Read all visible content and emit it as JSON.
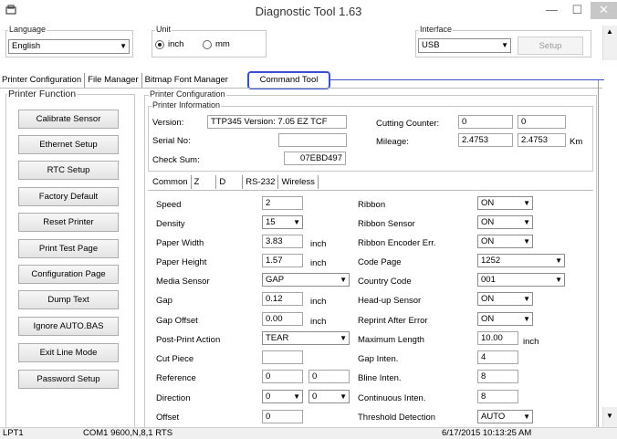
{
  "window": {
    "title": "Diagnostic Tool 1.63"
  },
  "top": {
    "language_legend": "Language",
    "language_value": "English",
    "unit_legend": "Unit",
    "unit_inch": "inch",
    "unit_mm": "mm",
    "interface_legend": "Interface",
    "interface_value": "USB",
    "setup_label": "Setup"
  },
  "tabs": [
    "Printer Configuration",
    "File Manager",
    "Bitmap Font Manager",
    "Command Tool"
  ],
  "printer_function": {
    "legend": "Printer Function",
    "buttons": [
      "Calibrate Sensor",
      "Ethernet Setup",
      "RTC Setup",
      "Factory Default",
      "Reset Printer",
      "Print Test Page",
      "Configuration Page",
      "Dump Text",
      "Ignore AUTO.BAS",
      "Exit Line Mode",
      "Password Setup"
    ]
  },
  "config": {
    "legend": "Printer Configuration",
    "info_legend": "Printer Information",
    "version_label": "Version:",
    "version_value": "TTP345 Version: 7.05 EZ TCF",
    "serial_label": "Serial No:",
    "serial_value": "",
    "checksum_label": "Check Sum:",
    "checksum_value": "07EBD497",
    "cutting_label": "Cutting Counter:",
    "cutting_1": "0",
    "cutting_2": "0",
    "mileage_label": "Mileage:",
    "mileage_1": "2.4753",
    "mileage_2": "2.4753",
    "mileage_unit": "Km"
  },
  "subtabs": [
    "Common",
    "Z",
    "D",
    "RS-232",
    "Wireless"
  ],
  "params_left": {
    "speed": {
      "label": "Speed",
      "value": "2"
    },
    "density": {
      "label": "Density",
      "value": "15"
    },
    "paper_width": {
      "label": "Paper Width",
      "value": "3.83",
      "unit": "inch"
    },
    "paper_height": {
      "label": "Paper Height",
      "value": "1.57",
      "unit": "inch"
    },
    "media_sensor": {
      "label": "Media Sensor",
      "value": "GAP"
    },
    "gap": {
      "label": "Gap",
      "value": "0.12",
      "unit": "inch"
    },
    "gap_offset": {
      "label": "Gap Offset",
      "value": "0.00",
      "unit": "inch"
    },
    "post_print": {
      "label": "Post-Print Action",
      "value": "TEAR"
    },
    "cut_piece": {
      "label": "Cut Piece",
      "value": ""
    },
    "reference": {
      "label": "Reference",
      "value1": "0",
      "value2": "0"
    },
    "direction": {
      "label": "Direction",
      "value1": "0",
      "value2": "0"
    },
    "offset": {
      "label": "Offset",
      "value": "0"
    }
  },
  "params_right": {
    "ribbon": {
      "label": "Ribbon",
      "value": "ON"
    },
    "ribbon_sensor": {
      "label": "Ribbon Sensor",
      "value": "ON"
    },
    "ribbon_encoder": {
      "label": "Ribbon Encoder Err.",
      "value": "ON"
    },
    "code_page": {
      "label": "Code Page",
      "value": "1252"
    },
    "country_code": {
      "label": "Country Code",
      "value": "001"
    },
    "headup_sensor": {
      "label": "Head-up Sensor",
      "value": "ON"
    },
    "reprint": {
      "label": "Reprint After Error",
      "value": "ON"
    },
    "max_length": {
      "label": "Maximum Length",
      "value": "10.00",
      "unit": "inch"
    },
    "gap_inten": {
      "label": "Gap Inten.",
      "value": "4"
    },
    "bline_inten": {
      "label": "Bline Inten.",
      "value": "8"
    },
    "continuous_inten": {
      "label": "Continuous Inten.",
      "value": "8"
    },
    "threshold": {
      "label": "Threshold Detection",
      "value": "AUTO"
    }
  },
  "status": {
    "port": "LPT1",
    "com": "COM1 9600,N,8,1 RTS",
    "datetime": "6/17/2015 10:13:25 AM"
  },
  "colors": {
    "highlight": "#3b4fd6",
    "close": "#c7c7c7"
  }
}
